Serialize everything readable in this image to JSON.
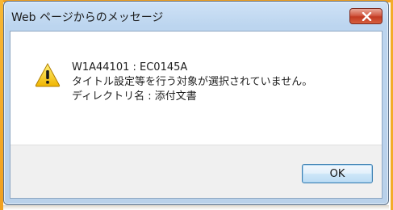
{
  "window": {
    "title": "Web ページからのメッセージ",
    "close_icon": "close-icon"
  },
  "message": {
    "icon": "warning-icon",
    "line1": "W1A44101 : EC0145A",
    "line2": "タイトル設定等を行う対象が選択されていません。",
    "line3": "ディレクトリ名 : 添付文書"
  },
  "buttons": {
    "ok_label": "OK"
  },
  "colors": {
    "frame": "#b9d1ea",
    "close_button": "#c23a22",
    "warning": "#f5c518",
    "background_strip": "#f0a020"
  }
}
